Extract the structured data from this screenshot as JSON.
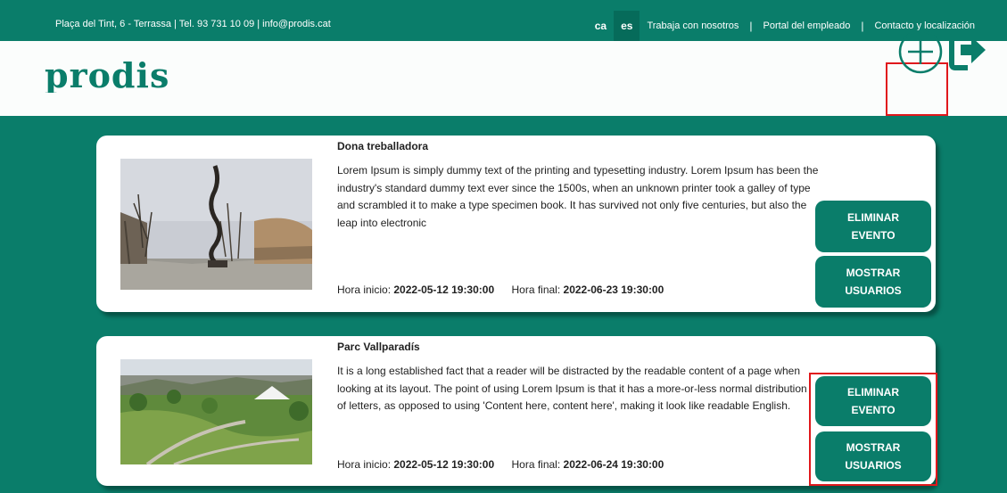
{
  "topbar": {
    "contact": "Plaça del Tint, 6 - Terrassa | Tel. 93 731 10 09 | info@prodis.cat",
    "lang_ca": "ca",
    "lang_es": "es",
    "link_jobs": "Trabaja con nosotros",
    "sep": "|",
    "link_employee": "Portal del empleado",
    "link_contact": "Contacto y localización"
  },
  "header": {
    "logo": "prodis",
    "add_icon": "plus-circle-icon",
    "logout_icon": "logout-icon"
  },
  "colors": {
    "brand": "#0a7d6a",
    "highlight": "#e0181c"
  },
  "events": [
    {
      "title": "Dona treballadora",
      "description": "Lorem Ipsum is simply dummy text of the printing and typesetting industry. Lorem Ipsum has been the industry's standard dummy text ever since the 1500s, when an unknown printer took a galley of type and scrambled it to make a type specimen book. It has survived not only five centuries, but also the leap into electronic",
      "start_label": "Hora inicio:",
      "start": "2022-05-12 19:30:00",
      "end_label": "Hora final:",
      "end": "2022-06-23 19:30:00",
      "delete_label": "ELIMINAR EVENTO",
      "users_label": "MOSTRAR USUARIOS"
    },
    {
      "title": "Parc Vallparadís",
      "description": "It is a long established fact that a reader will be distracted by the readable content of a page when looking at its layout. The point of using Lorem Ipsum is that it has a more-or-less normal distribution of letters, as opposed to using 'Content here, content here', making it look like readable English.",
      "start_label": "Hora inicio:",
      "start": "2022-05-12 19:30:00",
      "end_label": "Hora final:",
      "end": "2022-06-24 19:30:00",
      "delete_label": "ELIMINAR EVENTO",
      "users_label": "MOSTRAR USUARIOS"
    }
  ]
}
